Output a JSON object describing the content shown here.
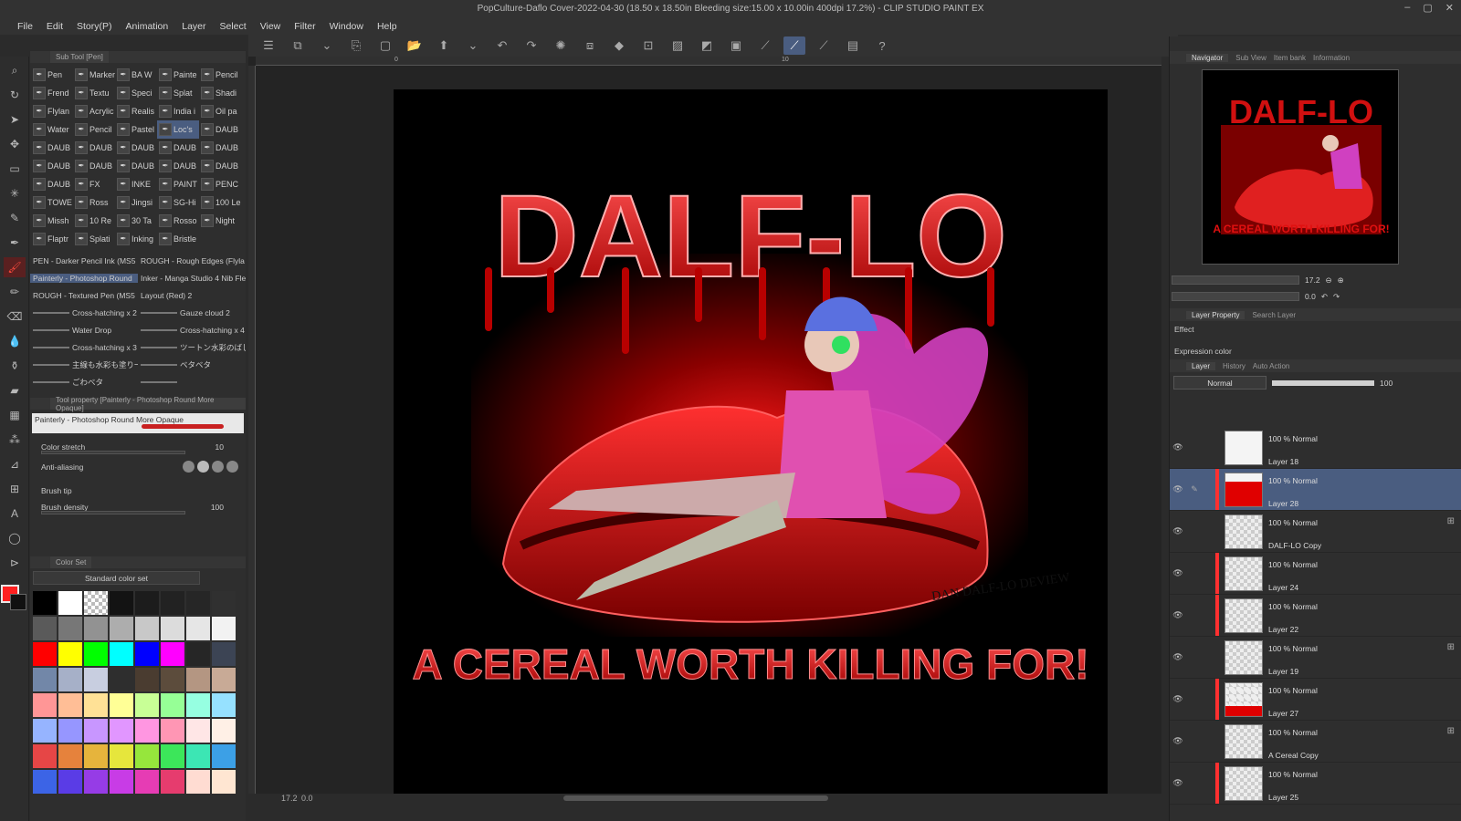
{
  "app": {
    "title": "PopCulture-Daflo Cover-2022-04-30 (18.50 x 18.50in Bleeding size:15.00 x 10.00in 400dpi 17.2%) - CLIP STUDIO PAINT EX",
    "window_controls": [
      "–",
      "▢",
      "✕"
    ]
  },
  "menu": [
    "File",
    "Edit",
    "Story(P)",
    "Animation",
    "Layer",
    "Select",
    "View",
    "Filter",
    "Window",
    "Help"
  ],
  "command_bar": {
    "icons": [
      "menu-icon",
      "new-icon",
      "chevron-down-icon",
      "copy-icon",
      "new-file-icon",
      "open-icon",
      "save-icon",
      "chevron-down-icon",
      "undo-icon",
      "redo-icon",
      "loading-icon",
      "clear-icon",
      "fill-icon",
      "transform-icon",
      "crop-icon",
      "deselect-icon",
      "invert-icon",
      "snap-ruler-icon",
      "snap-special-icon",
      "snap-grid-icon",
      "pen-pressure-icon",
      "help-icon"
    ],
    "glyphs": [
      "☰",
      "⧉",
      "⌄",
      "⎘",
      "▢",
      "📂",
      "⬆",
      "⌄",
      "↶",
      "↷",
      "✺",
      "⧈",
      "◆",
      "⊡",
      "▨",
      "◩",
      "▣",
      "⟋",
      "⟋",
      "⟋",
      "▤",
      "?"
    ],
    "active_index": 18
  },
  "tools": [
    {
      "name": "zoom-icon",
      "g": "⌕"
    },
    {
      "name": "rotate-icon",
      "g": "↻"
    },
    {
      "name": "operation-icon",
      "g": "➤"
    },
    {
      "name": "move-icon",
      "g": "✥"
    },
    {
      "name": "selection-icon",
      "g": "▭"
    },
    {
      "name": "auto-select-icon",
      "g": "✳"
    },
    {
      "name": "eyedropper-icon",
      "g": "✎"
    },
    {
      "name": "pen-icon",
      "g": "✒"
    },
    {
      "name": "brush-icon",
      "g": "🖌"
    },
    {
      "name": "pencil-icon",
      "g": "✏"
    },
    {
      "name": "eraser-icon",
      "g": "⌫"
    },
    {
      "name": "blend-icon",
      "g": "💧"
    },
    {
      "name": "airbrush-icon",
      "g": "⚱"
    },
    {
      "name": "fill-icon",
      "g": "▰"
    },
    {
      "name": "gradient-icon",
      "g": "▦"
    },
    {
      "name": "decoration-icon",
      "g": "⁂"
    },
    {
      "name": "figure-icon",
      "g": "⊿"
    },
    {
      "name": "frame-icon",
      "g": "⊞"
    },
    {
      "name": "text-icon",
      "g": "A"
    },
    {
      "name": "balloon-icon",
      "g": "◯"
    },
    {
      "name": "correct-line-icon",
      "g": "⊳"
    }
  ],
  "sub_tool": {
    "tab": "Sub Tool [Pen]",
    "items": [
      "Pen",
      "Marker",
      "BA W",
      "Painte",
      "Pencil",
      "Frend",
      "Textu",
      "Speci",
      "Splat",
      "Shadi",
      "Flylan",
      "Acrylic",
      "Realis",
      "India i",
      "Oil pa",
      "Water",
      "Pencil",
      "Pastel",
      "Loc's",
      "DAUB",
      "DAUB",
      "DAUB",
      "DAUB",
      "DAUB",
      "DAUB",
      "DAUB",
      "DAUB",
      "DAUB",
      "DAUB",
      "DAUB",
      "DAUB",
      "FX",
      "INKE",
      "PAINT",
      "PENC",
      "TOWE",
      "Ross",
      "Jingsi",
      "SG-Hi",
      "100 Le",
      "Missh",
      "10 Re",
      "30 Ta",
      "Rosso",
      "Night",
      "Flaptr",
      "Splati",
      "Inking",
      "Bristle"
    ],
    "selected_index": 18,
    "brushes": [
      [
        "PEN - Darker Pencil Ink (MS5",
        "ROUGH - Rough Edges (Flyla"
      ],
      [
        "Painterly - Photoshop Round",
        "Inker - Manga Studio 4 Nib Fle"
      ],
      [
        "ROUGH - Textured Pen (MS5",
        "Layout (Red) 2"
      ],
      [
        "Cross-hatching x 2",
        "Gauze cloud 2"
      ],
      [
        "Water Drop",
        "Cross-hatching x 4"
      ],
      [
        "Cross-hatching x 3",
        "ツートン水彩のばし"
      ],
      [
        "主線も水彩も塗り一本で",
        "ベタベタ"
      ],
      [
        "ごわべタ",
        ""
      ]
    ],
    "brush_selected": [
      1,
      0
    ]
  },
  "tool_property": {
    "tab": "Tool property [Painterly - Photoshop Round More Opaque]",
    "name": "Painterly - Photoshop Round More Opaque",
    "color_stretch_label": "Color stretch",
    "color_stretch_value": "10",
    "anti_aliasing_label": "Anti-aliasing",
    "brush_tip_label": "Brush tip",
    "brush_density_label": "Brush density",
    "brush_density_value": "100"
  },
  "color_set": {
    "tab": "Color Set",
    "set_name": "Standard color set",
    "swatches": [
      "#000000",
      "#ffffff",
      "checker",
      "#131313",
      "#1c1c1c",
      "#222222",
      "#262626",
      "#303030",
      "#5a5a5a",
      "#777777",
      "#929292",
      "#adadad",
      "#c8c8c8",
      "#dcdcdc",
      "#e6e6e6",
      "#f2f2f2",
      "#ff0000",
      "#ffff00",
      "#00ff00",
      "#00ffff",
      "#0000ff",
      "#ff00ff",
      "#262626",
      "#3c4454",
      "#7287a8",
      "#a6b0c8",
      "#c8cee0",
      "#2e2e2e",
      "#4a3c30",
      "#5c4c3c",
      "#b49682",
      "#c8aa96",
      "#ff9696",
      "#ffbe96",
      "#ffe196",
      "#ffff96",
      "#c8ff96",
      "#96ff96",
      "#96ffe1",
      "#96e1ff",
      "#96b4ff",
      "#9696ff",
      "#c896ff",
      "#e196ff",
      "#ff96e1",
      "#ff96b4",
      "#ffe6e6",
      "#fff0e6",
      "#e64646",
      "#e6823c",
      "#e6b43c",
      "#e6e63c",
      "#96e63c",
      "#3ce65a",
      "#3ce6b4",
      "#3ca0e6",
      "#3c64e6",
      "#5a3ce6",
      "#963ce6",
      "#c83ce6",
      "#e63cb4",
      "#e63c6e",
      "#ffdcd2",
      "#ffe6d2"
    ],
    "main_color": "#ff2020",
    "sub_color": "#111111"
  },
  "canvas": {
    "title_art": "DALF-LO",
    "tagline_art": "A CEREAL WORTH KILLING FOR!",
    "signature": "DAN DALF-LO DEVIEW",
    "ruler_marks": [
      "0",
      "10"
    ],
    "status_zoom": "17.2",
    "status_angle": "0.0"
  },
  "right": {
    "nav_tabs": [
      "Navigator",
      "Sub View",
      "Item bank",
      "Information"
    ],
    "nav_zoom": "17.2",
    "nav_angle": "0.0",
    "prop_tabs": [
      "Layer Property",
      "Search Layer"
    ],
    "effect_label": "Effect",
    "expression_label": "Expression color",
    "layer_tabs": [
      "Layer",
      "History",
      "Auto Action"
    ],
    "blend_mode": "Normal",
    "opacity": "100",
    "layers": [
      {
        "pct": "100 % Normal",
        "name": "Layer 18",
        "strip": "",
        "thumb": "white",
        "sel": false,
        "icon": ""
      },
      {
        "pct": "100 % Normal",
        "name": "Layer 28",
        "strip": "#ff3030",
        "thumb": "red",
        "sel": true,
        "icon": ""
      },
      {
        "pct": "100 % Normal",
        "name": "DALF-LO Copy",
        "strip": "",
        "thumb": "checker",
        "sel": false,
        "icon": "⊞"
      },
      {
        "pct": "100 % Normal",
        "name": "Layer 24",
        "strip": "#ff3030",
        "thumb": "checker",
        "sel": false,
        "icon": ""
      },
      {
        "pct": "100 % Normal",
        "name": "Layer 22",
        "strip": "#ff3030",
        "thumb": "checker",
        "sel": false,
        "icon": ""
      },
      {
        "pct": "100 % Normal",
        "name": "Layer 19",
        "strip": "",
        "thumb": "checker",
        "sel": false,
        "icon": "⊞"
      },
      {
        "pct": "100 % Normal",
        "name": "Layer 27",
        "strip": "#ff3030",
        "thumb": "redband",
        "sel": false,
        "icon": ""
      },
      {
        "pct": "100 % Normal",
        "name": "A Cereal Copy",
        "strip": "",
        "thumb": "checker",
        "sel": false,
        "icon": "⊞"
      },
      {
        "pct": "100 % Normal",
        "name": "Layer 25",
        "strip": "#ff3030",
        "thumb": "checker",
        "sel": false,
        "icon": ""
      }
    ]
  }
}
